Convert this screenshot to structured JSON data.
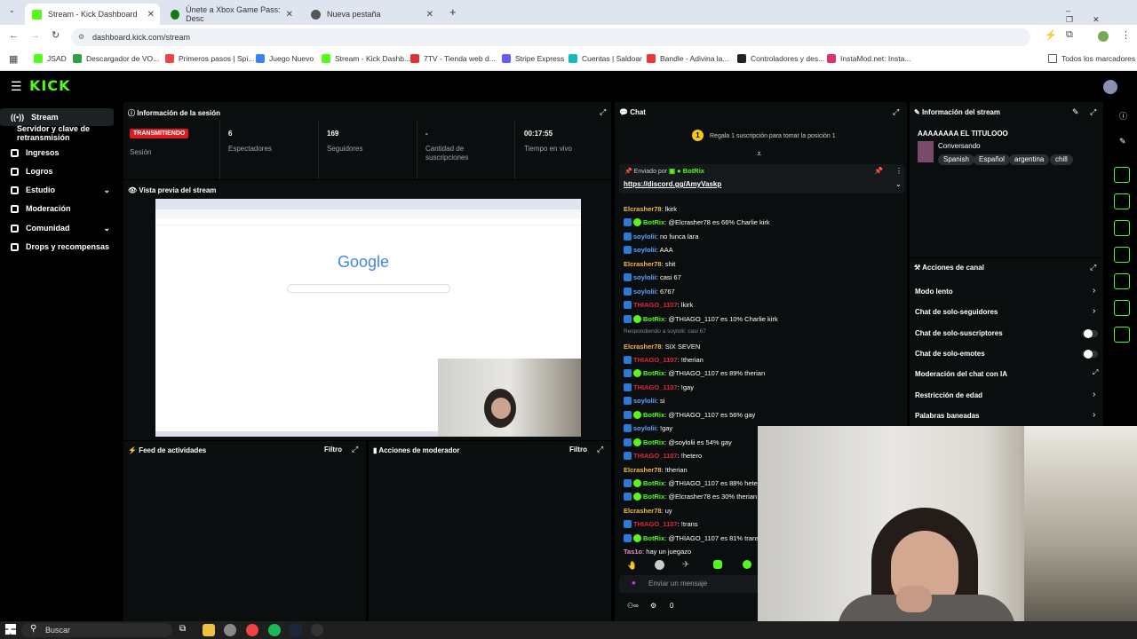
{
  "browser": {
    "tabs": [
      {
        "label": "Stream - Kick Dashboard",
        "color": "#53fc18"
      },
      {
        "label": "Únete a Xbox Game Pass: Desc",
        "color": "#107c10"
      },
      {
        "label": "Nueva pestaña",
        "color": "#555"
      }
    ],
    "url": "dashboard.kick.com/stream",
    "bookmarks": [
      {
        "label": "JSAD",
        "color": "#53fc18"
      },
      {
        "label": "Descargador de VO...",
        "color": "#2ea043"
      },
      {
        "label": "Primeros pasos | Spi...",
        "color": "#e44"
      },
      {
        "label": "Juego Nuevo",
        "color": "#3b82f6"
      },
      {
        "label": "Stream - Kick Dashb...",
        "color": "#53fc18"
      },
      {
        "label": "7TV - Tienda web d...",
        "color": "#d33"
      },
      {
        "label": "Stripe Express",
        "color": "#635bff"
      },
      {
        "label": "Cuentas | Saldoar",
        "color": "#1bb"
      },
      {
        "label": "Bandle - Adivina la...",
        "color": "#e33"
      },
      {
        "label": "Controladores y des...",
        "color": "#222"
      },
      {
        "label": "InstaMod.net: Insta...",
        "color": "#e1306c"
      }
    ],
    "all_bookmarks": "Todos los marcadores"
  },
  "sidebar": {
    "items": [
      {
        "label": "Stream"
      },
      {
        "label": "Servidor y clave de retransmisión"
      },
      {
        "label": "Ingresos"
      },
      {
        "label": "Logros"
      },
      {
        "label": "Estudio"
      },
      {
        "label": "Moderación"
      },
      {
        "label": "Comunidad"
      },
      {
        "label": "Drops y recompensas"
      }
    ]
  },
  "session": {
    "title": "Información de la sesión",
    "status": "TRANSMITIENDO",
    "status_label": "Sesión",
    "viewers": "6",
    "viewers_label": "Espectadores",
    "followers": "169",
    "followers_label": "Seguidores",
    "subs": "-",
    "subs_label": "Cantidad de suscripciones",
    "time": "00:17:55",
    "time_label": "Tiempo en vivo"
  },
  "preview": {
    "title": "Vista previa del stream",
    "google": "Google"
  },
  "activity": {
    "title": "Feed de actividades",
    "filter": "Filtro"
  },
  "modactions": {
    "title": "Acciones de moderador",
    "filter": "Filtro"
  },
  "chat": {
    "title": "Chat",
    "sub_prompt": "Regala 1 suscripción para tomar la posición 1",
    "pinned_by": "Enviado por",
    "pinned_user": "BotRix",
    "pinned_link": "https://discord.gg/AmyVaskp",
    "messages": [
      {
        "user": "Elcrasher78",
        "text": ": lkirk",
        "color": "#f5b84b",
        "b": 0
      },
      {
        "user": "BotRix",
        "text": ": @Elcrasher78 es 66% Charlie kirk",
        "color": "#53fc18",
        "b": 2
      },
      {
        "user": "soylolii",
        "text": ": no funca lara",
        "color": "#5aa7ff",
        "b": 1
      },
      {
        "user": "soylolii",
        "text": ": AAA",
        "color": "#5aa7ff",
        "b": 1
      },
      {
        "user": "Elcrasher78",
        "text": ": shit",
        "color": "#f5b84b",
        "b": 0
      },
      {
        "user": "soylolii",
        "text": ": casi 67",
        "color": "#5aa7ff",
        "b": 1
      },
      {
        "user": "soylolii",
        "text": ": 6767",
        "color": "#5aa7ff",
        "b": 1
      },
      {
        "user": "THIAGO_1107",
        "text": ": lkirk",
        "color": "#e0263a",
        "b": 1
      },
      {
        "user": "BotRix",
        "text": ": @THIAGO_1107 es 10% Charlie kirk",
        "color": "#53fc18",
        "b": 2
      },
      {
        "user": "Respondiendo a soylolii: casi 67",
        "text": "",
        "color": "#889",
        "b": -1
      },
      {
        "user": "Elcrasher78",
        "text": ": SIX SEVEN",
        "color": "#f5b84b",
        "b": 0
      },
      {
        "user": "THIAGO_1107",
        "text": ": !therian",
        "color": "#e0263a",
        "b": 1
      },
      {
        "user": "BotRix",
        "text": ": @THIAGO_1107 es 89% therian",
        "color": "#53fc18",
        "b": 2
      },
      {
        "user": "THIAGO_1107",
        "text": ": !gay",
        "color": "#e0263a",
        "b": 1
      },
      {
        "user": "soylolii",
        "text": ": si",
        "color": "#5aa7ff",
        "b": 1
      },
      {
        "user": "BotRix",
        "text": ": @THIAGO_1107 es 56% gay",
        "color": "#53fc18",
        "b": 2
      },
      {
        "user": "soylolii",
        "text": ": !gay",
        "color": "#5aa7ff",
        "b": 1
      },
      {
        "user": "BotRix",
        "text": ": @soylolii es 54% gay",
        "color": "#53fc18",
        "b": 2
      },
      {
        "user": "THIAGO_1107",
        "text": ": !hetero",
        "color": "#e0263a",
        "b": 1
      },
      {
        "user": "Elcrasher78",
        "text": ": !therian",
        "color": "#f5b84b",
        "b": 0
      },
      {
        "user": "BotRix",
        "text": ": @THIAGO_1107 es 88% hetero",
        "color": "#53fc18",
        "b": 2
      },
      {
        "user": "BotRix",
        "text": ": @Elcrasher78 es 30% therian",
        "color": "#53fc18",
        "b": 2
      },
      {
        "user": "Elcrasher78",
        "text": ": uy",
        "color": "#f5b84b",
        "b": 0
      },
      {
        "user": "THIAGO_1107",
        "text": ": !trans",
        "color": "#e0263a",
        "b": 1
      },
      {
        "user": "BotRix",
        "text": ": @THIAGO_1107 es 81% transex",
        "color": "#53fc18",
        "b": 2
      },
      {
        "user": "Tas1o",
        "text": ": hay un juegazo",
        "color": "#e88fc8",
        "b": 0
      }
    ],
    "input_placeholder": "Enviar un mensaje",
    "count": "0"
  },
  "streaminfo": {
    "title": "Información del stream",
    "stream_title": "AAAAAAAA EL TITULOOO",
    "category": "Conversando",
    "tags": [
      "Spanish",
      "Español",
      "argentina",
      "chill"
    ]
  },
  "channel": {
    "title": "Acciones de canal",
    "items": [
      {
        "label": "Modo lento",
        "type": "arrow"
      },
      {
        "label": "Chat de solo-seguidores",
        "type": "arrow"
      },
      {
        "label": "Chat de solo-suscriptores",
        "type": "toggle"
      },
      {
        "label": "Chat de solo-emotes",
        "type": "toggle"
      },
      {
        "label": "Moderación del chat con IA",
        "type": "ext"
      },
      {
        "label": "Restricción de edad",
        "type": "arrow"
      },
      {
        "label": "Palabras baneadas",
        "type": "arrow"
      }
    ]
  },
  "taskbar": {
    "search": "Buscar"
  }
}
